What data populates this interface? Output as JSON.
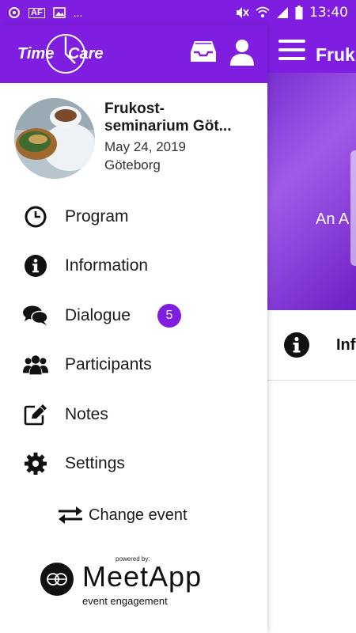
{
  "status_bar": {
    "left_icons": [
      "data-saver-icon",
      "af-icon",
      "image-icon",
      "more-dots-icon"
    ],
    "right_icons": [
      "mute-icon",
      "wifi-icon",
      "signal-icon",
      "battery-icon"
    ],
    "af_text": "AF",
    "dots": "...",
    "time": "13:40"
  },
  "colors": {
    "brand": "#7f1ee0",
    "badge": "#7f1ee0"
  },
  "drawer": {
    "logo": {
      "left": "Time",
      "right": "Care"
    },
    "header_icons": [
      "inbox-icon",
      "user-icon"
    ],
    "event": {
      "title_line1": "Frukost-",
      "title_line2": "seminarium Göt...",
      "date": "May 24, 2019",
      "location": "Göteborg"
    },
    "menu": [
      {
        "label": "Program",
        "icon": "clock-icon"
      },
      {
        "label": "Information",
        "icon": "info-icon"
      },
      {
        "label": "Dialogue",
        "icon": "chat-icon",
        "badge": "5"
      },
      {
        "label": "Participants",
        "icon": "users-icon"
      },
      {
        "label": "Notes",
        "icon": "edit-icon"
      },
      {
        "label": "Settings",
        "icon": "gear-icon"
      }
    ],
    "change_event": "Change event",
    "powered_by": "powered by:",
    "brand_name": "MeetApp",
    "brand_tagline": "event engagement"
  },
  "background": {
    "title": "Fruk",
    "banner_text": "An A",
    "info_label": "Inf"
  }
}
